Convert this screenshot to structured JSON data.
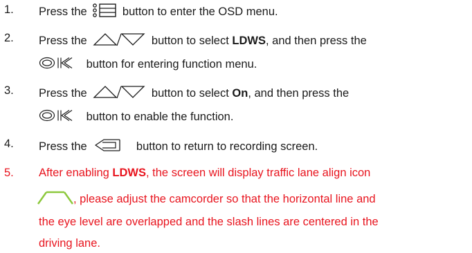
{
  "steps": [
    {
      "num": "1.",
      "a": "Press the",
      "icon": "menu-icon",
      "b": "button to enter the OSD menu."
    },
    {
      "num": "2.",
      "a": "Press the",
      "icon": "up-down-arrow-icons",
      "b": "button to select",
      "bold": "LDWS",
      "c": ", and then press the",
      "icon2": "ok-icon",
      "d": "button for entering function menu."
    },
    {
      "num": "3.",
      "a": "Press the",
      "icon": "up-down-arrow-icons",
      "b": "button to select",
      "bold": "On",
      "c": ", and then press the",
      "icon2": "ok-icon",
      "d": "button to enable the function."
    },
    {
      "num": "4.",
      "a": "Press the",
      "icon": "return-icon",
      "b": "button to return to recording screen."
    },
    {
      "num": "5.",
      "a": "After enabling",
      "bold": "LDWS",
      "b": ", the screen will display traffic lane align icon",
      "icon": "lane-align-icon",
      "c": ", please adjust the camcorder so that the horizontal line and",
      "d": "the eye level are overlapped and the slash lines are centered in the",
      "e": "driving lane."
    }
  ],
  "colors": {
    "text": "#1a1a1a",
    "highlight": "#e8141e",
    "lane_icon": "#8cc83c"
  }
}
